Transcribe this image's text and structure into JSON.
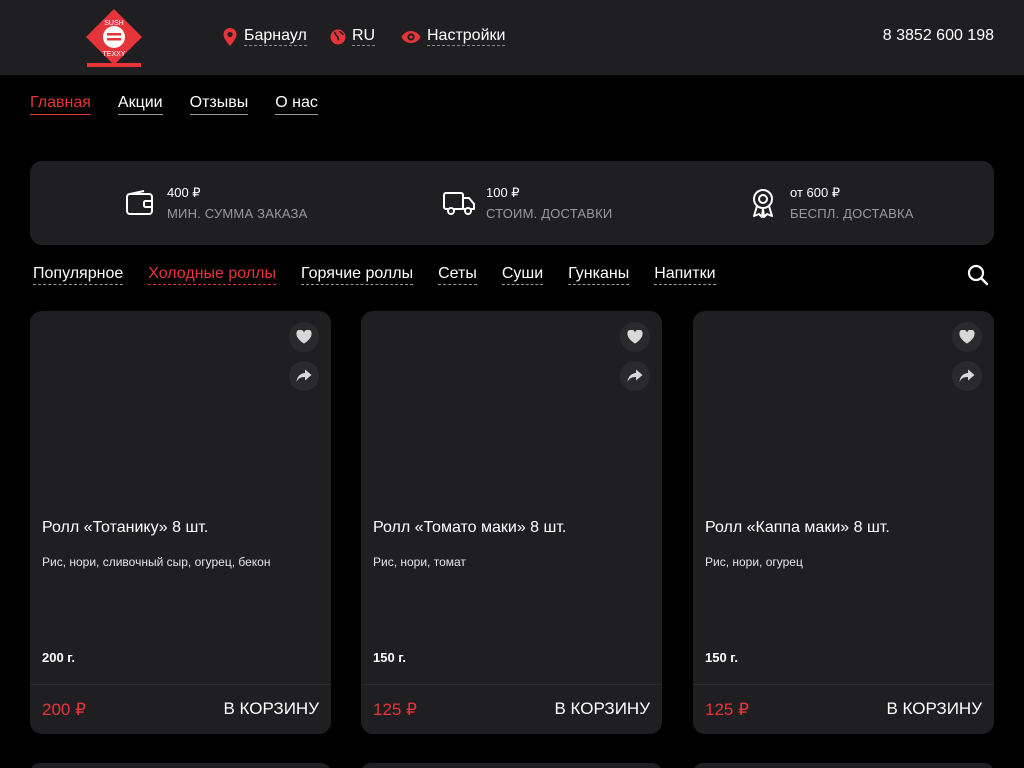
{
  "header": {
    "logo": {
      "top_text": "SUSH",
      "bottom_text": "TEXXY"
    },
    "city": "Барнаул",
    "language": "RU",
    "settings": "Настройки",
    "phone": "8 3852 600 198"
  },
  "main_nav": [
    {
      "label": "Главная",
      "active": true
    },
    {
      "label": "Акции",
      "active": false
    },
    {
      "label": "Отзывы",
      "active": false
    },
    {
      "label": "О нас",
      "active": false
    }
  ],
  "info": [
    {
      "icon": "wallet-icon",
      "value": "400 ₽",
      "label": "МИН. СУММА ЗАКАЗА"
    },
    {
      "icon": "truck-icon",
      "value": "100 ₽",
      "label": "СТОИМ. ДОСТАВКИ"
    },
    {
      "icon": "award-icon",
      "value": "от 600 ₽",
      "label": "БЕСПЛ. ДОСТАВКА"
    }
  ],
  "categories": [
    {
      "label": "Популярное",
      "active": false
    },
    {
      "label": "Холодные роллы",
      "active": true
    },
    {
      "label": "Горячие роллы",
      "active": false
    },
    {
      "label": "Сеты",
      "active": false
    },
    {
      "label": "Суши",
      "active": false
    },
    {
      "label": "Гунканы",
      "active": false
    },
    {
      "label": "Напитки",
      "active": false
    }
  ],
  "products": [
    {
      "title": "Ролл «Тотанику» 8 шт.",
      "desc": "Рис, нори, сливочный сыр, огурец, бекон",
      "weight": "200 г.",
      "price": "200 ₽",
      "cart": "В КОРЗИНУ"
    },
    {
      "title": "Ролл «Томато маки» 8 шт.",
      "desc": "Рис, нори, томат",
      "weight": "150 г.",
      "price": "125 ₽",
      "cart": "В КОРЗИНУ"
    },
    {
      "title": "Ролл «Каппа маки» 8 шт.",
      "desc": "Рис, нори, огурец",
      "weight": "150 г.",
      "price": "125 ₽",
      "cart": "В КОРЗИНУ"
    }
  ],
  "colors": {
    "accent": "#e5343a",
    "panel": "#1f1f21",
    "background": "#000000"
  }
}
